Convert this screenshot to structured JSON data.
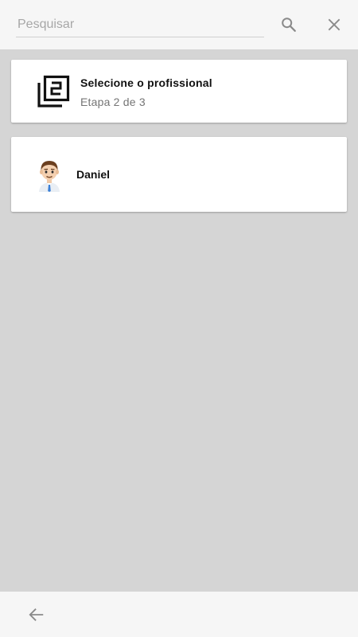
{
  "search": {
    "value": "",
    "placeholder": "Pesquisar",
    "search_icon": "search-icon",
    "close_icon": "close-icon"
  },
  "step": {
    "icon": "filter-2-icon",
    "title": "Selecione o profissional",
    "subtitle": "Etapa 2 de 3"
  },
  "professionals": [
    {
      "name": "Daniel",
      "avatar": "avatar-man-icon"
    }
  ],
  "bottom_bar": {
    "back_icon": "arrow-back-icon"
  },
  "colors": {
    "background": "#d5d5d5",
    "bar": "#f6f6f6",
    "card": "#ffffff",
    "icon_gray": "#8a8a8a"
  }
}
